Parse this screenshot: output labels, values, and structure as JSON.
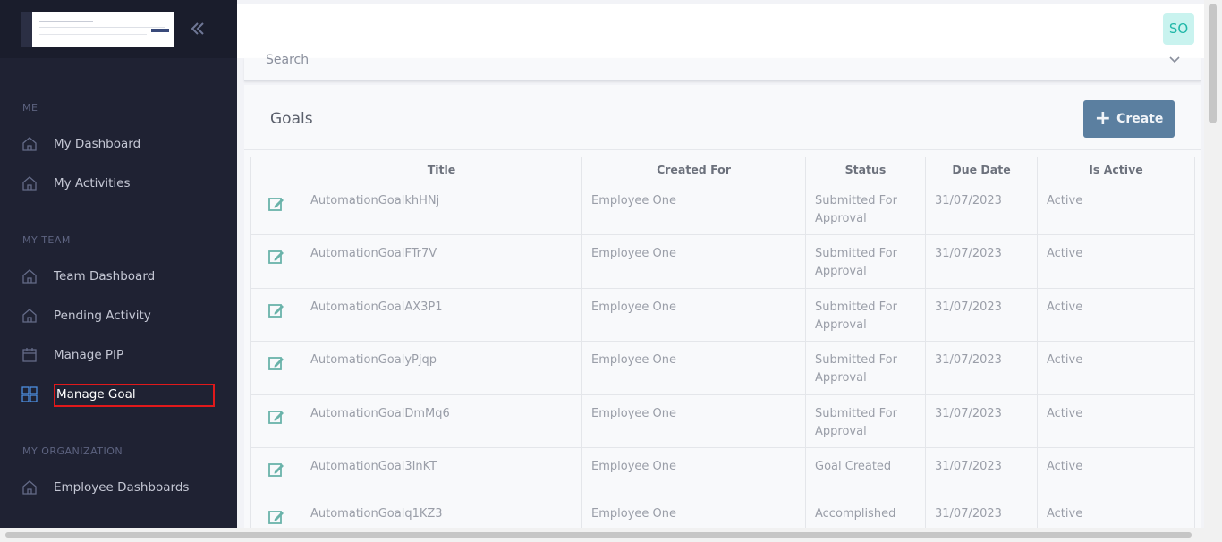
{
  "sidebar": {
    "sections": {
      "me": "ME",
      "my_team": "MY TEAM",
      "my_org": "MY ORGANIZATION"
    },
    "items": [
      {
        "label": "My Dashboard",
        "icon": "home-icon"
      },
      {
        "label": "My Activities",
        "icon": "home-icon"
      },
      {
        "label": "Team Dashboard",
        "icon": "home-icon"
      },
      {
        "label": "Pending Activity",
        "icon": "home-icon"
      },
      {
        "label": "Manage PIP",
        "icon": "calendar-icon"
      },
      {
        "label": "Manage Goal",
        "icon": "grid-icon",
        "active": true
      },
      {
        "label": "Employee Dashboards",
        "icon": "home-icon"
      }
    ]
  },
  "header": {
    "avatar_initials": "SO"
  },
  "search": {
    "label": "Search"
  },
  "goals": {
    "title": "Goals",
    "create_label": "Create",
    "columns": [
      "Title",
      "Created For",
      "Status",
      "Due Date",
      "Is Active"
    ],
    "rows": [
      {
        "title": "AutomationGoalkhHNj",
        "created_for": "Employee One",
        "status": "Submitted For Approval",
        "due": "31/07/2023",
        "active": "Active"
      },
      {
        "title": "AutomationGoalFTr7V",
        "created_for": "Employee One",
        "status": "Submitted For Approval",
        "due": "31/07/2023",
        "active": "Active"
      },
      {
        "title": "AutomationGoalAX3P1",
        "created_for": "Employee One",
        "status": "Submitted For Approval",
        "due": "31/07/2023",
        "active": "Active"
      },
      {
        "title": "AutomationGoalyPjqp",
        "created_for": "Employee One",
        "status": "Submitted For Approval",
        "due": "31/07/2023",
        "active": "Active"
      },
      {
        "title": "AutomationGoalDmMq6",
        "created_for": "Employee One",
        "status": "Submitted For Approval",
        "due": "31/07/2023",
        "active": "Active"
      },
      {
        "title": "AutomationGoal3InKT",
        "created_for": "Employee One",
        "status": "Goal Created",
        "due": "31/07/2023",
        "active": "Active"
      },
      {
        "title": "AutomationGoalq1KZ3",
        "created_for": "Employee One",
        "status": "Accomplished",
        "due": "31/07/2023",
        "active": "Active"
      }
    ]
  },
  "colors": {
    "sidebar_bg": "#1f2233",
    "accent": "#5b7fa0",
    "edit_icon": "#6ab3aa",
    "highlight_border": "#e0191b"
  }
}
